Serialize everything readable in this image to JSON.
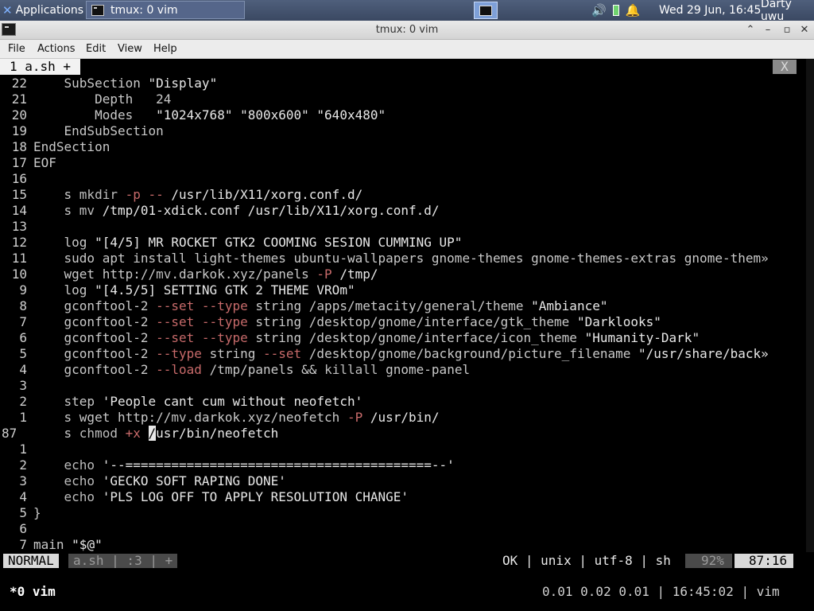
{
  "panel": {
    "apps_label": "Applications",
    "task_label": "tmux: 0 vim",
    "clock": "Wed 29 Jun, 16:45",
    "user": "Darty uwu"
  },
  "window": {
    "title": "tmux: 0 vim"
  },
  "menu": [
    "File",
    "Actions",
    "Edit",
    "View",
    "Help"
  ],
  "buffer": {
    "tab_label": "1 a.sh +",
    "close_label": "X"
  },
  "lines": [
    {
      "n": "22",
      "segs": [
        [
          "    SubSection ",
          "kw"
        ],
        [
          "\"Display\"",
          "str"
        ]
      ]
    },
    {
      "n": "21",
      "segs": [
        [
          "        Depth   24",
          "kw"
        ]
      ]
    },
    {
      "n": "20",
      "segs": [
        [
          "        Modes   ",
          "kw"
        ],
        [
          "\"1024x768\" \"800x600\" \"640x480\"",
          "str"
        ]
      ]
    },
    {
      "n": "19",
      "segs": [
        [
          "    EndSubSection",
          "kw"
        ]
      ]
    },
    {
      "n": "18",
      "segs": [
        [
          "EndSection",
          "kw"
        ]
      ]
    },
    {
      "n": "17",
      "segs": [
        [
          "EOF",
          "kw"
        ]
      ]
    },
    {
      "n": "16",
      "segs": []
    },
    {
      "n": "15",
      "segs": [
        [
          "    s ",
          "kw"
        ],
        [
          "mkdir ",
          "cmd"
        ],
        [
          "-p -- ",
          "op"
        ],
        [
          "/usr/lib/X11/xorg.conf.d/",
          "str"
        ]
      ]
    },
    {
      "n": "14",
      "segs": [
        [
          "    s ",
          "kw"
        ],
        [
          "mv ",
          "cmd"
        ],
        [
          "/tmp/01-xdick.conf /usr/lib/X11/xorg.conf.d/",
          "str"
        ]
      ]
    },
    {
      "n": "13",
      "segs": []
    },
    {
      "n": "12",
      "segs": [
        [
          "    log ",
          "kw"
        ],
        [
          "\"[4/5] MR ROCKET GTK2 COOMING SESION CUMMING UP\"",
          "str"
        ]
      ]
    },
    {
      "n": "11",
      "segs": [
        [
          "    sudo apt install light-themes ubuntu-wallpapers gnome-themes gnome-themes-extras gnome-them»",
          "kw"
        ]
      ]
    },
    {
      "n": "10",
      "segs": [
        [
          "    wget http://",
          "kw"
        ],
        [
          "mv",
          "cmd"
        ],
        [
          ".darkok.xyz/panels ",
          "kw"
        ],
        [
          "-P ",
          "op"
        ],
        [
          "/tmp/",
          "str"
        ]
      ]
    },
    {
      "n": "9",
      "segs": [
        [
          "    log ",
          "kw"
        ],
        [
          "\"[4.5/5] SETTING GTK 2 THEME VROm\"",
          "str"
        ]
      ]
    },
    {
      "n": "8",
      "segs": [
        [
          "    gconftool-2 ",
          "kw"
        ],
        [
          "--set --type ",
          "op"
        ],
        [
          "string /apps/metacity/general/theme ",
          "kw"
        ],
        [
          "\"Ambiance\"",
          "str"
        ]
      ]
    },
    {
      "n": "7",
      "segs": [
        [
          "    gconftool-2 ",
          "kw"
        ],
        [
          "--set --type ",
          "op"
        ],
        [
          "string /desktop/gnome/interface/gtk_theme ",
          "kw"
        ],
        [
          "\"Darklooks\"",
          "str"
        ]
      ]
    },
    {
      "n": "6",
      "segs": [
        [
          "    gconftool-2 ",
          "kw"
        ],
        [
          "--set --type ",
          "op"
        ],
        [
          "string /desktop/gnome/interface/icon_theme ",
          "kw"
        ],
        [
          "\"Humanity-Dark\"",
          "str"
        ]
      ]
    },
    {
      "n": "5",
      "segs": [
        [
          "    gconftool-2 ",
          "kw"
        ],
        [
          "--type ",
          "op"
        ],
        [
          "string ",
          "kw"
        ],
        [
          "--set ",
          "op"
        ],
        [
          "/desktop/gnome/background/picture_filename ",
          "kw"
        ],
        [
          "\"/usr/share/back»",
          "str"
        ]
      ]
    },
    {
      "n": "4",
      "segs": [
        [
          "    gconftool-2 ",
          "kw"
        ],
        [
          "--load ",
          "op"
        ],
        [
          "/tmp/panels && ",
          "kw"
        ],
        [
          "killall ",
          "cmd"
        ],
        [
          "gnome-panel",
          "kw"
        ]
      ]
    },
    {
      "n": "3",
      "segs": []
    },
    {
      "n": "2",
      "segs": [
        [
          "    step ",
          "kw"
        ],
        [
          "'People cant cum without neofetch'",
          "str"
        ]
      ]
    },
    {
      "n": "1",
      "segs": [
        [
          "    s wget http://",
          "kw"
        ],
        [
          "mv",
          "cmd"
        ],
        [
          ".darkok.xyz/neofetch ",
          "kw"
        ],
        [
          "-P ",
          "op"
        ],
        [
          "/usr/bin/",
          "str"
        ]
      ]
    },
    {
      "n": "87",
      "cur": true,
      "segs": [
        [
          "    s ",
          "kw"
        ],
        [
          "chmod ",
          "cmd"
        ],
        [
          "+x ",
          "op"
        ],
        [
          "/",
          "cursor"
        ],
        [
          "usr/bin/neofetch",
          "str"
        ]
      ]
    },
    {
      "n": "1",
      "segs": []
    },
    {
      "n": "2",
      "segs": [
        [
          "    echo ",
          "cmd"
        ],
        [
          "'--========================================--'",
          "str"
        ]
      ]
    },
    {
      "n": "3",
      "segs": [
        [
          "    echo ",
          "cmd"
        ],
        [
          "'GECKO SOFT RAPING DONE'",
          "str"
        ]
      ]
    },
    {
      "n": "4",
      "segs": [
        [
          "    echo ",
          "cmd"
        ],
        [
          "'PLS LOG OFF TO APPLY RESOLUTION CHANGE'",
          "str"
        ]
      ]
    },
    {
      "n": "5",
      "segs": [
        [
          "}",
          "kw"
        ]
      ]
    },
    {
      "n": "6",
      "segs": []
    },
    {
      "n": "7",
      "segs": [
        [
          "main ",
          "kw"
        ],
        [
          "\"$@\"",
          "str"
        ]
      ]
    }
  ],
  "statusline": {
    "mode": "NORMAL",
    "segments": "a.sh | :3 | +",
    "info": "OK | unix | utf-8 | sh",
    "percent": "92%",
    "position": "87:16"
  },
  "tmux": {
    "window": "*0 vim",
    "right": "0.01 0.02 0.01 | 16:45:02 | vim"
  }
}
